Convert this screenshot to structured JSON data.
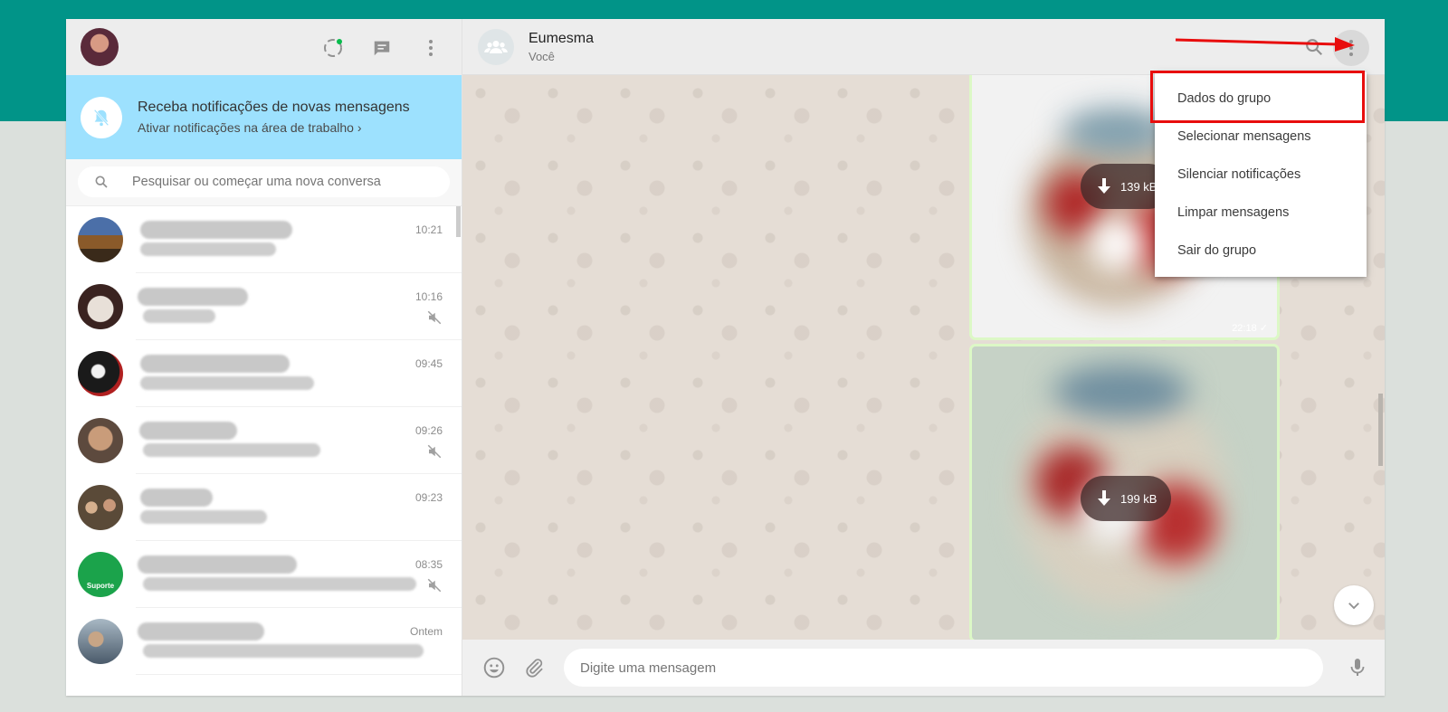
{
  "left": {
    "notification": {
      "title": "Receba notificações de novas mensagens",
      "subtitle": "Ativar notificações na área de trabalho",
      "chevron": "›"
    },
    "search": {
      "placeholder": "Pesquisar ou começar uma nova conversa"
    },
    "chats": [
      {
        "time": "10:21",
        "muted": false
      },
      {
        "time": "10:16",
        "muted": true
      },
      {
        "time": "09:45",
        "muted": false
      },
      {
        "time": "09:26",
        "muted": true
      },
      {
        "time": "09:23",
        "muted": false
      },
      {
        "time": "08:35",
        "muted": true,
        "avatar_label": "Suporte"
      },
      {
        "time": "Ontem",
        "muted": false
      }
    ]
  },
  "conversation": {
    "name": "Eumesma",
    "subtitle": "Você",
    "messages": [
      {
        "size": "139 kB",
        "time": "22:18 ✓"
      },
      {
        "size": "199 kB"
      }
    ],
    "composer": {
      "placeholder": "Digite uma mensagem"
    }
  },
  "menu": {
    "items": [
      "Dados do grupo",
      "Selecionar mensagens",
      "Silenciar notificações",
      "Limpar mensagens",
      "Sair do grupo"
    ]
  },
  "colors": {
    "accent_band": "#019488",
    "notification_banner": "#9de1fe",
    "highlight": "#e80d0d"
  }
}
